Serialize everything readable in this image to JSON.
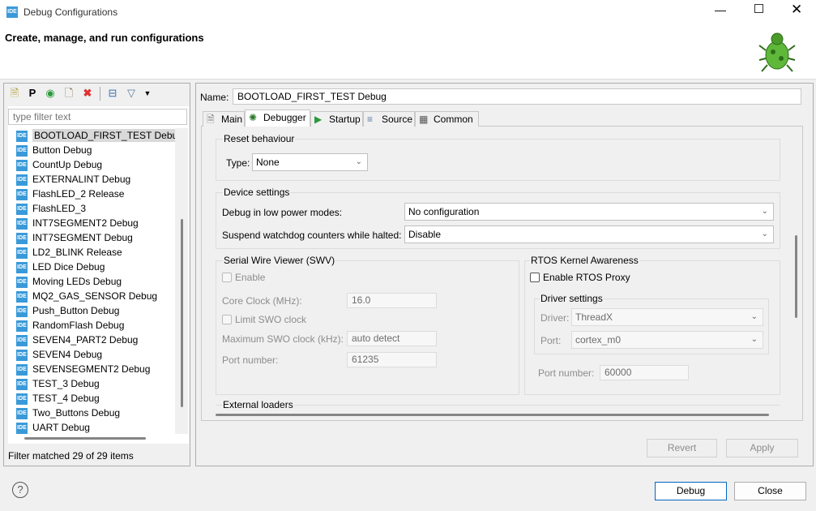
{
  "window": {
    "title": "Debug Configurations",
    "app_icon": "IDE",
    "controls": [
      "minimize",
      "maximize",
      "close"
    ]
  },
  "header": {
    "subtitle": "Create, manage, and run configurations",
    "icon": "bug-icon"
  },
  "left": {
    "toolbar": [
      "new-config-icon",
      "new-prototype-icon",
      "export-icon",
      "duplicate-icon",
      "delete-icon",
      "collapse-all-icon",
      "filter-icon",
      "dropdown-icon"
    ],
    "filter_placeholder": "type filter text",
    "items": [
      "BOOTLOAD_FIRST_TEST Debug",
      "Button Debug",
      "CountUp Debug",
      "EXTERNALINT Debug",
      "FlashLED_2 Release",
      "FlashLED_3",
      "INT7SEGMENT2 Debug",
      "INT7SEGMENT Debug",
      "LD2_BLINK Release",
      "LED Dice Debug",
      "Moving LEDs Debug",
      "MQ2_GAS_SENSOR Debug",
      "Push_Button Debug",
      "RandomFlash Debug",
      "SEVEN4_PART2 Debug",
      "SEVEN4 Debug",
      "SEVENSEGMENT2 Debug",
      "TEST_3 Debug",
      "TEST_4 Debug",
      "Two_Buttons Debug",
      "UART Debug"
    ],
    "item_icon": "IDE",
    "selected": "BOOTLOAD_FIRST_TEST Debug",
    "status": "Filter matched 29 of 29 items"
  },
  "right": {
    "name_label": "Name:",
    "name_value": "BOOTLOAD_FIRST_TEST Debug",
    "tabs": [
      "Main",
      "Debugger",
      "Startup",
      "Source",
      "Common"
    ],
    "active_tab": "Debugger",
    "reset": {
      "title": "Reset behaviour",
      "type_label": "Type:",
      "type_value": "None"
    },
    "device": {
      "title": "Device settings",
      "low_power_label": "Debug in low power modes:",
      "low_power_value": "No configuration",
      "watchdog_label": "Suspend watchdog counters while halted:",
      "watchdog_value": "Disable"
    },
    "swv": {
      "title": "Serial Wire Viewer (SWV)",
      "enable": "Enable",
      "core_clock_label": "Core Clock (MHz):",
      "core_clock": "16.0",
      "limit_swo": "Limit SWO clock",
      "max_swo_label": "Maximum SWO clock (kHz):",
      "max_swo": "auto detect",
      "port_label": "Port number:",
      "port": "61235"
    },
    "rtos": {
      "title": "RTOS Kernel Awareness",
      "enable_proxy": "Enable RTOS Proxy",
      "driver_settings": "Driver settings",
      "driver_label": "Driver:",
      "driver": "ThreadX",
      "port_label": "Port:",
      "port": "cortex_m0",
      "port_number_label": "Port number:",
      "port_number": "60000"
    },
    "external_loaders": "External loaders",
    "revert": "Revert",
    "apply": "Apply"
  },
  "footer": {
    "debug": "Debug",
    "close": "Close"
  }
}
